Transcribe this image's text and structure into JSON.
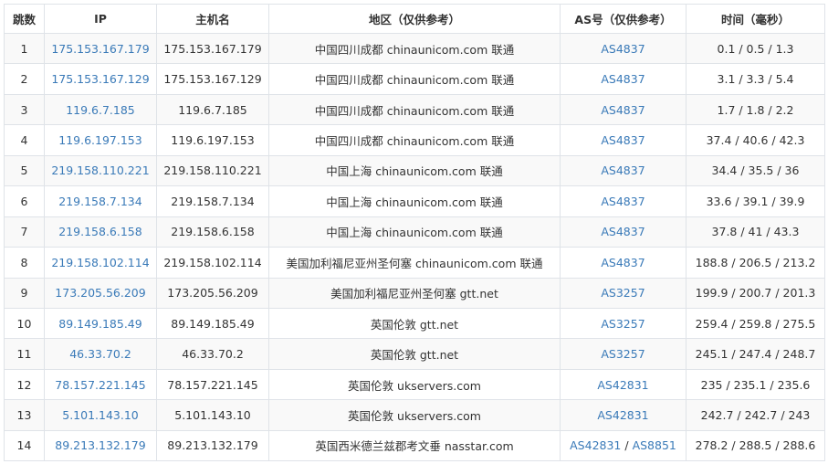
{
  "headers": {
    "hop": "跳数",
    "ip": "IP",
    "host": "主机名",
    "region": "地区（仅供参考）",
    "as": "AS号（仅供参考）",
    "time": "时间（毫秒）"
  },
  "rows": [
    {
      "hop": "1",
      "ip": "175.153.167.179",
      "host": "175.153.167.179",
      "region": "中国四川成都 chinaunicom.com 联通",
      "as": [
        "AS4837"
      ],
      "time": "0.1 / 0.5 / 1.3"
    },
    {
      "hop": "2",
      "ip": "175.153.167.129",
      "host": "175.153.167.129",
      "region": "中国四川成都 chinaunicom.com 联通",
      "as": [
        "AS4837"
      ],
      "time": "3.1 / 3.3 / 5.4"
    },
    {
      "hop": "3",
      "ip": "119.6.7.185",
      "host": "119.6.7.185",
      "region": "中国四川成都 chinaunicom.com 联通",
      "as": [
        "AS4837"
      ],
      "time": "1.7 / 1.8 / 2.2"
    },
    {
      "hop": "4",
      "ip": "119.6.197.153",
      "host": "119.6.197.153",
      "region": "中国四川成都 chinaunicom.com 联通",
      "as": [
        "AS4837"
      ],
      "time": "37.4 / 40.6 / 42.3"
    },
    {
      "hop": "5",
      "ip": "219.158.110.221",
      "host": "219.158.110.221",
      "region": "中国上海 chinaunicom.com 联通",
      "as": [
        "AS4837"
      ],
      "time": "34.4 / 35.5 / 36"
    },
    {
      "hop": "6",
      "ip": "219.158.7.134",
      "host": "219.158.7.134",
      "region": "中国上海 chinaunicom.com 联通",
      "as": [
        "AS4837"
      ],
      "time": "33.6 / 39.1 / 39.9"
    },
    {
      "hop": "7",
      "ip": "219.158.6.158",
      "host": "219.158.6.158",
      "region": "中国上海 chinaunicom.com 联通",
      "as": [
        "AS4837"
      ],
      "time": "37.8 / 41 / 43.3"
    },
    {
      "hop": "8",
      "ip": "219.158.102.114",
      "host": "219.158.102.114",
      "region": "美国加利福尼亚州圣何塞 chinaunicom.com 联通",
      "as": [
        "AS4837"
      ],
      "time": "188.8 / 206.5 / 213.2"
    },
    {
      "hop": "9",
      "ip": "173.205.56.209",
      "host": "173.205.56.209",
      "region": "美国加利福尼亚州圣何塞 gtt.net",
      "as": [
        "AS3257"
      ],
      "time": "199.9 / 200.7 / 201.3"
    },
    {
      "hop": "10",
      "ip": "89.149.185.49",
      "host": "89.149.185.49",
      "region": "英国伦敦 gtt.net",
      "as": [
        "AS3257"
      ],
      "time": "259.4 / 259.8 / 275.5"
    },
    {
      "hop": "11",
      "ip": "46.33.70.2",
      "host": "46.33.70.2",
      "region": "英国伦敦 gtt.net",
      "as": [
        "AS3257"
      ],
      "time": "245.1 / 247.4 / 248.7"
    },
    {
      "hop": "12",
      "ip": "78.157.221.145",
      "host": "78.157.221.145",
      "region": "英国伦敦 ukservers.com",
      "as": [
        "AS42831"
      ],
      "time": "235 / 235.1 / 235.6"
    },
    {
      "hop": "13",
      "ip": "5.101.143.10",
      "host": "5.101.143.10",
      "region": "英国伦敦 ukservers.com",
      "as": [
        "AS42831"
      ],
      "time": "242.7 / 242.7 / 243"
    },
    {
      "hop": "14",
      "ip": "89.213.132.179",
      "host": "89.213.132.179",
      "region": "英国西米德兰兹郡考文垂 nasstar.com",
      "as": [
        "AS42831",
        "AS8851"
      ],
      "time": "278.2 / 288.5 / 288.6"
    }
  ],
  "as_separator": "/",
  "colors": {
    "link": "#3a7ab8",
    "text": "#333333",
    "border": "#dfe3e8",
    "stripe": "#f9f9f9"
  }
}
